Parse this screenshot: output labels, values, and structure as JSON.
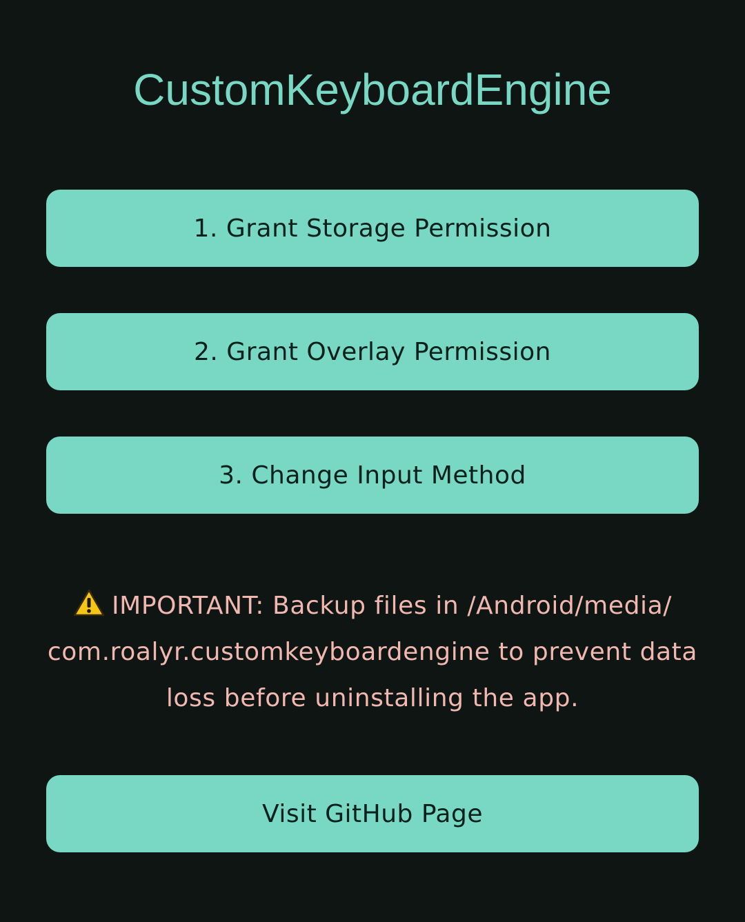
{
  "app": {
    "title": "CustomKeyboardEngine"
  },
  "buttons": {
    "grant_storage": "1. Grant Storage Permission",
    "grant_overlay": "2. Grant Overlay Permission",
    "change_input": "3. Change Input Method",
    "visit_github": "Visit GitHub Page"
  },
  "warning": {
    "icon": "warning-icon",
    "text": "IMPORTANT: Backup files in /Android/media/ com.roalyr.customkeyboardengine to prevent data loss before uninstalling the app."
  },
  "colors": {
    "background": "#0e1513",
    "accent": "#78d8c4",
    "button_text": "#06201b",
    "warning_text": "#f0b8b0",
    "warning_icon": "#f5c518"
  }
}
